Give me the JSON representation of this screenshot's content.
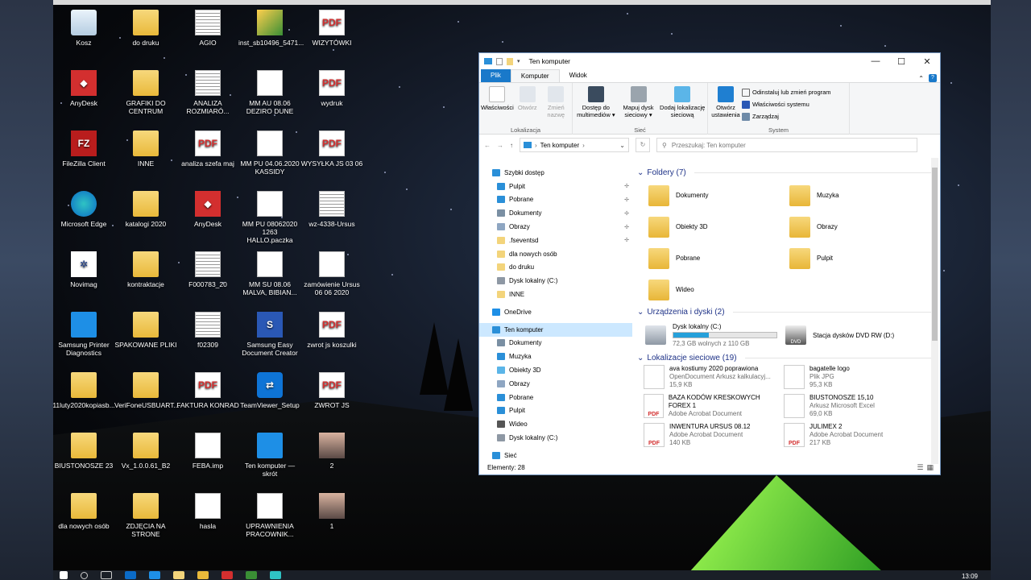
{
  "desktop_icons": [
    {
      "label": "Kosz",
      "icon": "recycle-bin-icon",
      "glyph": "",
      "kind": "bin"
    },
    {
      "label": "do druku",
      "icon": "folder-icon",
      "glyph": "",
      "kind": "folder"
    },
    {
      "label": "AGIO",
      "icon": "spreadsheet-icon",
      "glyph": "",
      "kind": "xls"
    },
    {
      "label": "inst_sb10496_5471...",
      "icon": "installer-icon",
      "glyph": "",
      "kind": "inst"
    },
    {
      "label": "WIZYTÓWKI",
      "icon": "pdf-icon",
      "glyph": "PDF",
      "kind": "pdf"
    },
    {
      "label": "AnyDesk",
      "icon": "anydesk-icon",
      "glyph": "◆",
      "kind": "red"
    },
    {
      "label": "GRAFIKI DO CENTRUM",
      "icon": "folder-icon",
      "glyph": "",
      "kind": "folder"
    },
    {
      "label": "ANALIZA ROZMIARÓ...",
      "icon": "spreadsheet-icon",
      "glyph": "",
      "kind": "xls"
    },
    {
      "label": "MM AU 08.06 DEZIRO DUNE",
      "icon": "document-icon",
      "glyph": "",
      "kind": "doc"
    },
    {
      "label": "wydruk",
      "icon": "pdf-icon",
      "glyph": "PDF",
      "kind": "pdf"
    },
    {
      "label": "FileZilla Client",
      "icon": "filezilla-icon",
      "glyph": "FZ",
      "kind": "fz"
    },
    {
      "label": "INNE",
      "icon": "folder-icon",
      "glyph": "",
      "kind": "folder"
    },
    {
      "label": "analiza szefa maj",
      "icon": "pdf-icon",
      "glyph": "PDF",
      "kind": "pdf"
    },
    {
      "label": "MM PU 04.06.2020 KASSIDY",
      "icon": "document-icon",
      "glyph": "",
      "kind": "doc"
    },
    {
      "label": "WYSYŁKA JS 03 06",
      "icon": "pdf-icon",
      "glyph": "PDF",
      "kind": "pdf"
    },
    {
      "label": "Microsoft Edge",
      "icon": "edge-icon",
      "glyph": "",
      "kind": "edge"
    },
    {
      "label": "katalogi 2020",
      "icon": "folder-icon",
      "glyph": "",
      "kind": "folder"
    },
    {
      "label": "AnyDesk",
      "icon": "anydesk-icon",
      "glyph": "◆",
      "kind": "red"
    },
    {
      "label": "MM PU 08062020 1263 HALLO.paczka",
      "icon": "document-icon",
      "glyph": "",
      "kind": "doc"
    },
    {
      "label": "wz-4338-Ursus",
      "icon": "spreadsheet-icon",
      "glyph": "",
      "kind": "xls"
    },
    {
      "label": "Novimag",
      "icon": "novimag-icon",
      "glyph": "✲",
      "kind": "nov"
    },
    {
      "label": "kontraktacje",
      "icon": "folder-icon",
      "glyph": "",
      "kind": "folder"
    },
    {
      "label": "F000783_20",
      "icon": "spreadsheet-icon",
      "glyph": "",
      "kind": "xls"
    },
    {
      "label": "MM SU 08.06 MALVA, BIBIAN...",
      "icon": "document-icon",
      "glyph": "",
      "kind": "doc"
    },
    {
      "label": "zamówienie Ursus 06 06 2020",
      "icon": "document-icon",
      "glyph": "",
      "kind": "doc"
    },
    {
      "label": "Samsung Printer Diagnostics",
      "icon": "printer-icon",
      "glyph": "",
      "kind": "pc"
    },
    {
      "label": "SPAKOWANE PLIKI",
      "icon": "folder-icon",
      "glyph": "",
      "kind": "folder"
    },
    {
      "label": "f02309",
      "icon": "spreadsheet-icon",
      "glyph": "",
      "kind": "xls"
    },
    {
      "label": "Samsung Easy Document Creator",
      "icon": "samsung-icon",
      "glyph": "S",
      "kind": "sam"
    },
    {
      "label": "zwrot js koszulki",
      "icon": "pdf-icon",
      "glyph": "PDF",
      "kind": "pdf"
    },
    {
      "label": "11luty2020kopiasb...",
      "icon": "folder-icon",
      "glyph": "",
      "kind": "folder"
    },
    {
      "label": "VeriFoneUSBUART...",
      "icon": "folder-icon",
      "glyph": "",
      "kind": "folder"
    },
    {
      "label": "FAKTURA KONRAD",
      "icon": "pdf-icon",
      "glyph": "PDF",
      "kind": "pdf"
    },
    {
      "label": "TeamViewer_Setup",
      "icon": "teamviewer-icon",
      "glyph": "⇄",
      "kind": "tv"
    },
    {
      "label": "ZWROT JS",
      "icon": "pdf-icon",
      "glyph": "PDF",
      "kind": "pdf"
    },
    {
      "label": "BIUSTONOSZE 23",
      "icon": "folder-icon",
      "glyph": "",
      "kind": "folder"
    },
    {
      "label": "Vx_1.0.0.61_B2",
      "icon": "folder-icon",
      "glyph": "",
      "kind": "folder"
    },
    {
      "label": "FEBA.imp",
      "icon": "document-icon",
      "glyph": "",
      "kind": "doc"
    },
    {
      "label": "Ten komputer — skrót",
      "icon": "computer-icon",
      "glyph": "",
      "kind": "pc"
    },
    {
      "label": "2",
      "icon": "photo-icon",
      "glyph": "",
      "kind": "photo"
    },
    {
      "label": "dla nowych osób",
      "icon": "folder-icon",
      "glyph": "",
      "kind": "folder"
    },
    {
      "label": "ZDJĘCIA NA STRONE",
      "icon": "folder-icon",
      "glyph": "",
      "kind": "folder"
    },
    {
      "label": "hasla",
      "icon": "document-icon",
      "glyph": "",
      "kind": "doc"
    },
    {
      "label": "UPRAWNIENIA PRACOWNIK...",
      "icon": "document-icon",
      "glyph": "",
      "kind": "doc"
    },
    {
      "label": "1",
      "icon": "photo-icon",
      "glyph": "",
      "kind": "photo"
    }
  ],
  "window": {
    "title": "Ten komputer",
    "controls": {
      "minimize": "—",
      "maximize": "☐",
      "close": "✕"
    },
    "tabs": [
      "Plik",
      "Komputer",
      "Widok"
    ],
    "ribbon": {
      "lokalizacja": {
        "name": "Lokalizacja",
        "buttons": [
          "Właściwości",
          "Otwórz",
          "Zmień nazwę"
        ]
      },
      "siec": {
        "name": "Sieć",
        "buttons": [
          "Dostęp do multimediów ▾",
          "Mapuj dysk sieciowy ▾",
          "Dodaj lokalizację sieciową"
        ]
      },
      "system": {
        "name": "System",
        "big": "Otwórz ustawienia",
        "small": [
          "Odinstaluj lub zmień program",
          "Właściwości systemu",
          "Zarządzaj"
        ]
      }
    },
    "address": {
      "path": "Ten komputer",
      "search_placeholder": "Przeszukaj: Ten komputer"
    },
    "nav": [
      {
        "label": "Szybki dostęp",
        "sub": false,
        "pin": false
      },
      {
        "label": "Pulpit",
        "sub": true,
        "pin": true
      },
      {
        "label": "Pobrane",
        "sub": true,
        "pin": true
      },
      {
        "label": "Dokumenty",
        "sub": true,
        "pin": true
      },
      {
        "label": "Obrazy",
        "sub": true,
        "pin": true
      },
      {
        "label": ".fseventsd",
        "sub": true,
        "pin": true
      },
      {
        "label": "dla nowych osób",
        "sub": true,
        "pin": false
      },
      {
        "label": "do druku",
        "sub": true,
        "pin": false
      },
      {
        "label": "Dysk lokalny (C:)",
        "sub": true,
        "pin": false
      },
      {
        "label": "INNE",
        "sub": true,
        "pin": false
      },
      {
        "label": "OneDrive",
        "sub": false,
        "pin": false
      },
      {
        "label": "Ten komputer",
        "sub": false,
        "pin": false,
        "selected": true
      },
      {
        "label": "Dokumenty",
        "sub": true,
        "pin": false
      },
      {
        "label": "Muzyka",
        "sub": true,
        "pin": false
      },
      {
        "label": "Obiekty 3D",
        "sub": true,
        "pin": false
      },
      {
        "label": "Obrazy",
        "sub": true,
        "pin": false
      },
      {
        "label": "Pobrane",
        "sub": true,
        "pin": false
      },
      {
        "label": "Pulpit",
        "sub": true,
        "pin": false
      },
      {
        "label": "Wideo",
        "sub": true,
        "pin": false
      },
      {
        "label": "Dysk lokalny (C:)",
        "sub": true,
        "pin": false
      },
      {
        "label": "Sieć",
        "sub": false,
        "pin": false
      }
    ],
    "folders_header": "Foldery (7)",
    "folders": [
      "Dokumenty",
      "Muzyka",
      "Obiekty 3D",
      "Obrazy",
      "Pobrane",
      "Pulpit",
      "Wideo"
    ],
    "devices_header": "Urządzenia i dyski (2)",
    "devices": [
      {
        "name": "Dysk lokalny (C:)",
        "free": "72,3 GB wolnych z 110 GB",
        "used_fraction": 0.34
      },
      {
        "name": "Stacja dysków DVD RW (D:)"
      }
    ],
    "network_header": "Lokalizacje sieciowe (19)",
    "network": [
      {
        "name": "ava kostiumy 2020 poprawiona",
        "type": "OpenDocument Arkusz kalkulacyj...",
        "size": "15,9 KB"
      },
      {
        "name": "bagatelle logo",
        "type": "Plik JPG",
        "size": "95,3 KB"
      },
      {
        "name": "BAZA KODÓW KRESKOWYCH FOREX 1",
        "type": "Adobe Acrobat Document",
        "size": ""
      },
      {
        "name": "BIUSTONOSZE 15,10",
        "type": "Arkusz Microsoft Excel",
        "size": "69,0 KB"
      },
      {
        "name": "INWENTURA URSUS 08.12",
        "type": "Adobe Acrobat Document",
        "size": "140 KB"
      },
      {
        "name": "JULIMEX 2",
        "type": "Adobe Acrobat Document",
        "size": "217 KB"
      }
    ],
    "status": "Elementy: 28"
  },
  "taskbar": {
    "time": "13:09"
  }
}
